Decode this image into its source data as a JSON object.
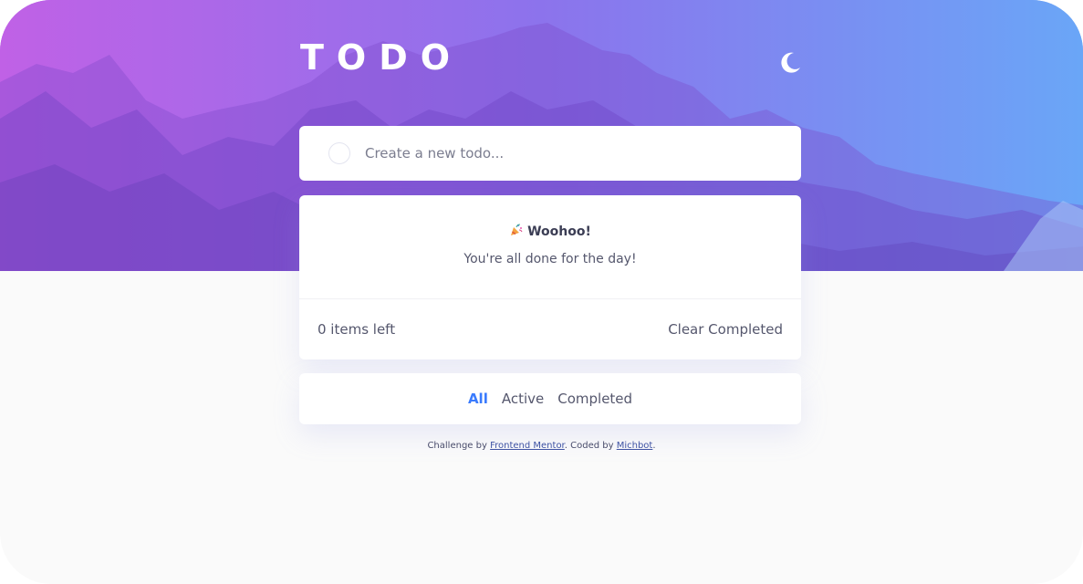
{
  "header": {
    "title": "TODO",
    "theme_icon": "moon-icon"
  },
  "new_todo": {
    "placeholder": "Create a new todo..."
  },
  "empty_state": {
    "icon": "party-popper-icon",
    "title": "Woohoo!",
    "message": "You're all done for the day!"
  },
  "list_footer": {
    "items_left": "0 items left",
    "clear_label": "Clear Completed"
  },
  "filters": {
    "all": "All",
    "active": "Active",
    "completed": "Completed",
    "selected": "All"
  },
  "attribution": {
    "prefix": "Challenge by",
    "link1": "Frontend Mentor",
    "middle": ". Coded by",
    "link2": "Michbot",
    "suffix": "."
  },
  "colors": {
    "accent": "#3a7bfd",
    "page_background": "#fafafa",
    "card_background": "#ffffff"
  }
}
